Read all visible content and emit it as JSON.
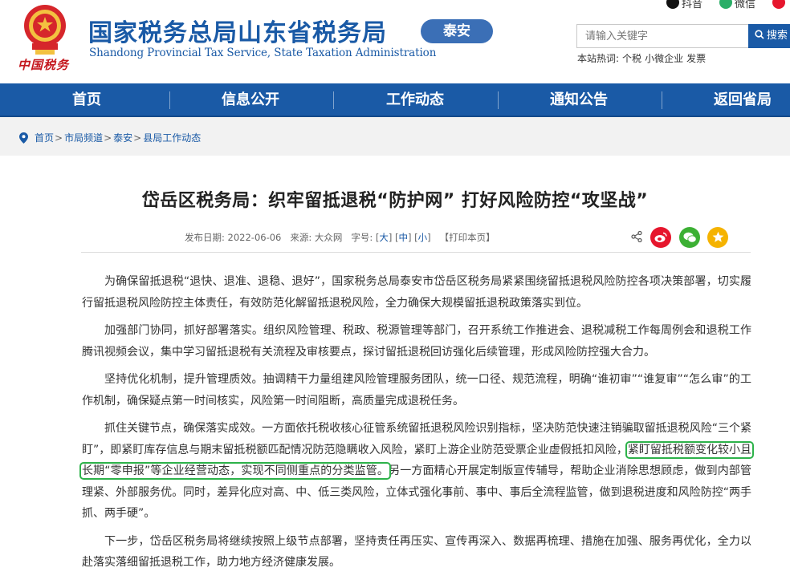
{
  "header": {
    "emblem_text": "中国税务",
    "title": "国家税务总局山东省税务局",
    "subtitle": "Shandong Provincial Tax Service, State Taxation Administration",
    "city": "泰安",
    "social": [
      {
        "label": "抖音",
        "icon": "douyin-icon"
      },
      {
        "label": "微信",
        "icon": "weixin-icon"
      },
      {
        "label": "",
        "icon": "weibo-icon"
      }
    ],
    "search": {
      "placeholder": "请输入关键字",
      "button": "搜索"
    },
    "hot_words": {
      "label": "本站热词:",
      "items": [
        "个税",
        "小微企业",
        "发票"
      ]
    }
  },
  "nav": {
    "items": [
      "首页",
      "信息公开",
      "工作动态",
      "通知公告",
      "返回省局"
    ]
  },
  "breadcrumb": {
    "items": [
      "首页",
      "市局频道",
      "泰安",
      "县局工作动态"
    ]
  },
  "article": {
    "title": "岱岳区税务局：织牢留抵退税“防护网” 打好风险防控“攻坚战”",
    "meta": {
      "date_label": "发布日期:",
      "date": "2022-06-06",
      "source_label": "来源:",
      "source": "大众网",
      "font_label": "字号:",
      "font_large": "大",
      "font_medium": "中",
      "font_small": "小",
      "print": "【打印本页】"
    },
    "paragraphs": [
      "为确保留抵退税“退快、退准、退稳、退好”，国家税务总局泰安市岱岳区税务局紧紧围绕留抵退税风险防控各项决策部署，切实履行留抵退税风险防控主体责任，有效防范化解留抵退税风险，全力确保大规模留抵退税政策落实到位。",
      "加强部门协同，抓好部署落实。组织风险管理、税政、税源管理等部门，召开系统工作推进会、退税减税工作每周例会和退税工作腾讯视频会议，集中学习留抵退税有关流程及审核要点，探讨留抵退税回访强化后续管理，形成风险防控强大合力。",
      "坚持优化机制，提升管理质效。抽调精干力量组建风险管理服务团队，统一口径、规范流程，明确“谁初审”“谁复审”“怎么审”的工作机制，确保疑点第一时间核实，风险第一时间阻断，高质量完成退税任务。"
    ],
    "p4_before": "抓住关键节点，确保落实成效。一方面依托税收核心征管系统留抵退税风险识别指标，坚决防范快速注销骗取留抵退税风险“三个紧盯”，即紧盯库存信息与期末留抵税额匹配情况防范隐瞒收入风险，紧盯上游企业防范受票企业虚假抵扣风险，",
    "p4_highlight": "紧盯留抵税额变化较小且长期“零申报”等企业经营动态，实现不同侧重点的分类监管。",
    "p4_after": "另一方面精心开展定制版宣传辅导，帮助企业消除思想顾虑，做到内部管理紧、外部服务优。同时，差异化应对高、中、低三类风险，立体式强化事前、事中、事后全流程监管，做到退税进度和风险防控“两手抓、两手硬”。",
    "p5": "下一步，岱岳区税务局将继续按照上级节点部署，坚持责任再压实、宣传再深入、数据再梳理、措施在加强、服务再优化，全力以赴落实落细留抵退税工作，助力地方经济健康发展。",
    "share_icons": [
      "share-icon",
      "weibo-icon",
      "weixin-icon",
      "star-icon"
    ]
  },
  "colors": {
    "brand_blue": "#1a5aa6",
    "highlight_green": "#2db24a",
    "emblem_red": "#c4161c"
  }
}
